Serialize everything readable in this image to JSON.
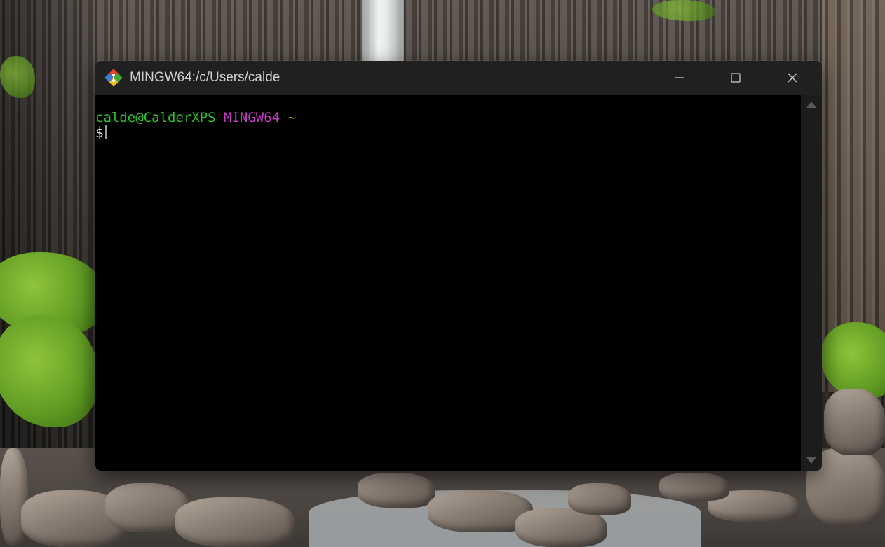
{
  "window": {
    "title": "MINGW64:/c/Users/calde",
    "buttons": {
      "minimize": "minimize-icon",
      "maximize": "maximize-icon",
      "close": "close-icon"
    }
  },
  "terminal": {
    "prompt_user": "calde@CalderXPS",
    "prompt_system": "MINGW64",
    "prompt_dir": "~",
    "prompt_symbol": "$",
    "colors": {
      "user": "#2bc12b",
      "system": "#c43bc4",
      "dir": "#c6a300",
      "background": "#000000"
    }
  },
  "icons": {
    "app": "git-bash-icon",
    "scroll_up": "chevron-up-icon",
    "scroll_down": "chevron-down-icon"
  }
}
